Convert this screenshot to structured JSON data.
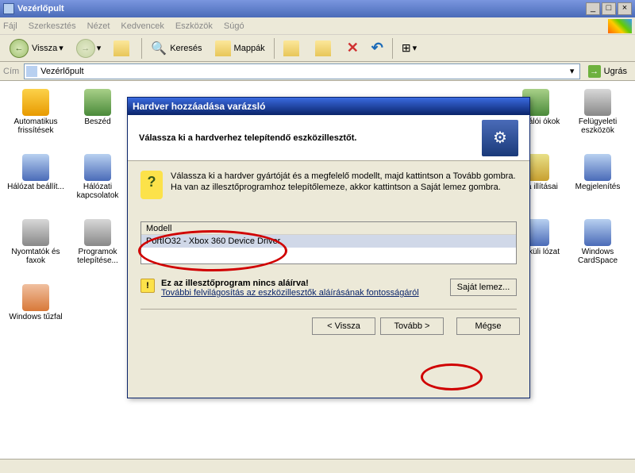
{
  "window": {
    "title": "Vezérlőpult",
    "min": "_",
    "max": "□",
    "close": "×"
  },
  "menu": {
    "file": "Fájl",
    "edit": "Szerkesztés",
    "view": "Nézet",
    "fav": "Kedvencek",
    "tools": "Eszközök",
    "help": "Súgó"
  },
  "toolbar": {
    "back": "Vissza",
    "back_arrow": "←",
    "fwd_arrow": "→",
    "up_arrow": "↑",
    "search": "Keresés",
    "folders": "Mappák"
  },
  "address": {
    "label": "Cím",
    "value": "Vezérlőpult",
    "go": "Ugrás",
    "go_arrow": "→"
  },
  "icons_left": [
    {
      "label": "Automatikus frissítések"
    },
    {
      "label": "Beszéd"
    },
    {
      "label": "Hálózat beállít..."
    },
    {
      "label": "Hálózati kapcsolatok"
    },
    {
      "label": "Nyomtatók és faxok"
    },
    {
      "label": "Programok telepítése..."
    },
    {
      "label": "Windows tűzfal"
    }
  ],
  "icons_r2": [
    {
      "label": "asználói ókok"
    },
    {
      "label": "appa illításai"
    },
    {
      "label": "k nélküli lózat"
    }
  ],
  "icons_right": [
    {
      "label": "Felügyeleti eszközök"
    },
    {
      "label": "Megjelenítés"
    },
    {
      "label": "Windows CardSpace"
    }
  ],
  "wizard": {
    "title": "Hardver hozzáadása varázsló",
    "header": "Válassza ki a hardverhez telepítendő eszközillesztőt.",
    "instruction": "Válassza ki a hardver gyártóját és a megfelelő modellt, majd kattintson a Tovább gombra. Ha van az illesztőprogramhoz telepítőlemeze, akkor kattintson a Saját lemez gombra.",
    "list_header": "Modell",
    "list_item": "PortIO32 - Xbox 360 Device Driver",
    "warn_title": "Ez az illesztőprogram nincs aláírva!",
    "warn_link": "További felvilágosítás az eszközillesztők aláírásának fontosságáról",
    "disk_btn": "Saját lemez...",
    "back_btn": "< Vissza",
    "next_btn": "Tovább >",
    "cancel_btn": "Mégse"
  }
}
